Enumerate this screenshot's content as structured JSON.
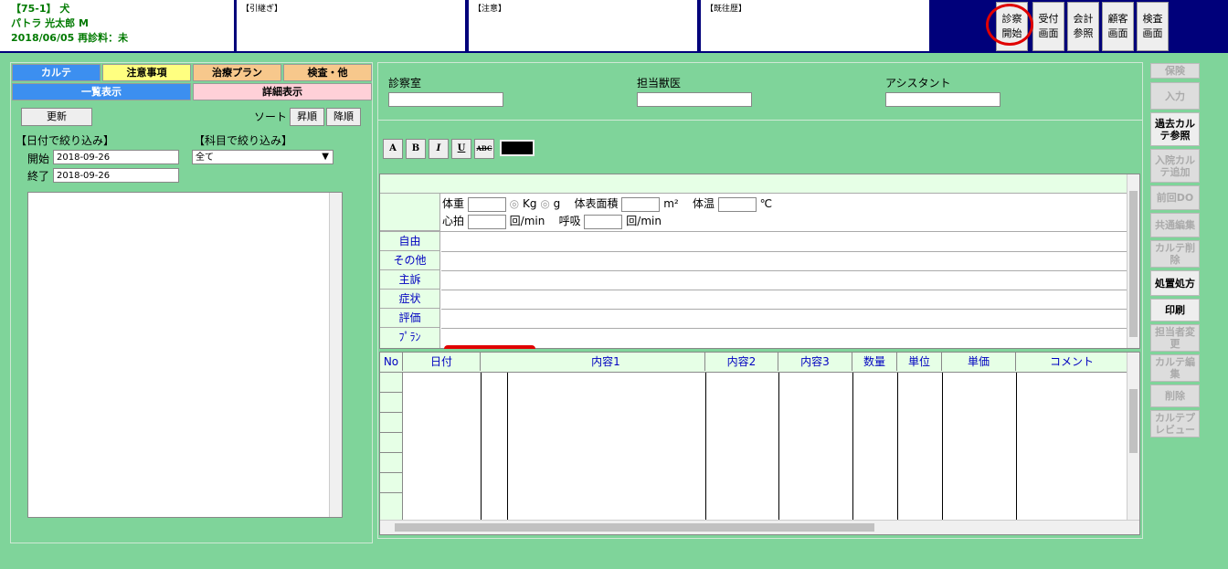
{
  "patient": {
    "line1": "【75-1】 犬",
    "line2": "パトラ 光太郎 M",
    "line3": "2018/06/05 再診料：未"
  },
  "memos": {
    "handover": "【引継ぎ】",
    "caution": "【注意】",
    "history": "【既往歴】"
  },
  "top_buttons": [
    {
      "label1": "診察",
      "label2": "開始"
    },
    {
      "label1": "受付",
      "label2": "画面"
    },
    {
      "label1": "会計",
      "label2": "参照"
    },
    {
      "label1": "顧客",
      "label2": "画面"
    },
    {
      "label1": "検査",
      "label2": "画面"
    }
  ],
  "left": {
    "tabs": [
      "カルテ",
      "注意事項",
      "治療プラン",
      "検査・他"
    ],
    "views": [
      "一覧表示",
      "詳細表示"
    ],
    "refresh": "更新",
    "sort_label": "ソート",
    "sort_asc": "昇順",
    "sort_desc": "降順",
    "date_filter": "【日付で絞り込み】",
    "subject_filter": "【科目で絞り込み】",
    "start_label": "開始",
    "end_label": "終了",
    "start_date": "2018-09-26",
    "end_date": "2018-09-26",
    "subject_value": "全て"
  },
  "exam": {
    "room": "診察室",
    "vet": "担当獣医",
    "assistant": "アシスタント"
  },
  "format_buttons": [
    "A",
    "B",
    "I",
    "U",
    "ABC"
  ],
  "vitals": {
    "weight": "体重",
    "kg": "Kg",
    "g": "g",
    "bsa": "体表面積",
    "m2": "m²",
    "temp": "体温",
    "celsius": "℃",
    "hr": "心拍",
    "per_min": "回/min",
    "resp": "呼吸",
    "per_min2": "回/min"
  },
  "record_rows": [
    "自由",
    "その他",
    "主訴",
    "症状",
    "評価",
    "ﾌﾟﾗﾝ"
  ],
  "table_headers": [
    "No",
    "日付",
    "",
    "内容1",
    "内容2",
    "内容3",
    "数量",
    "単位",
    "単価",
    "コメント"
  ],
  "side_buttons": [
    {
      "label": "保険",
      "on": false
    },
    {
      "label": "入力",
      "on": false
    },
    {
      "label": "過去カルテ参照",
      "on": true
    },
    {
      "label": "入院カルテ追加",
      "on": false
    },
    {
      "label": "前回DO",
      "on": false
    },
    {
      "label": "共通編集",
      "on": false
    },
    {
      "label": "カルテ削除",
      "on": false
    },
    {
      "label": "処置処方",
      "on": true
    },
    {
      "label": "印刷",
      "on": true
    },
    {
      "label": "担当者変更",
      "on": false
    },
    {
      "label": "カルテ編集",
      "on": false
    },
    {
      "label": "削除",
      "on": false
    },
    {
      "label": "カルテプレビュー",
      "on": false
    }
  ]
}
